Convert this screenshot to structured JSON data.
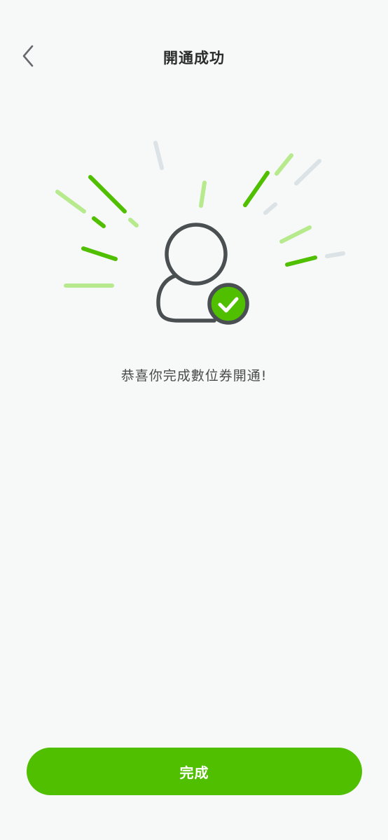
{
  "header": {
    "title": "開通成功"
  },
  "main": {
    "message": "恭喜你完成數位券開通!"
  },
  "footer": {
    "done_label": "完成"
  },
  "colors": {
    "accent": "#4fbf00",
    "accent_light": "#b7ea8c",
    "ray_gray": "#dce3e6",
    "icon_outline": "#4a4f52"
  },
  "icons": {
    "back": "chevron-left-icon",
    "illustration": "user-verified-icon"
  }
}
